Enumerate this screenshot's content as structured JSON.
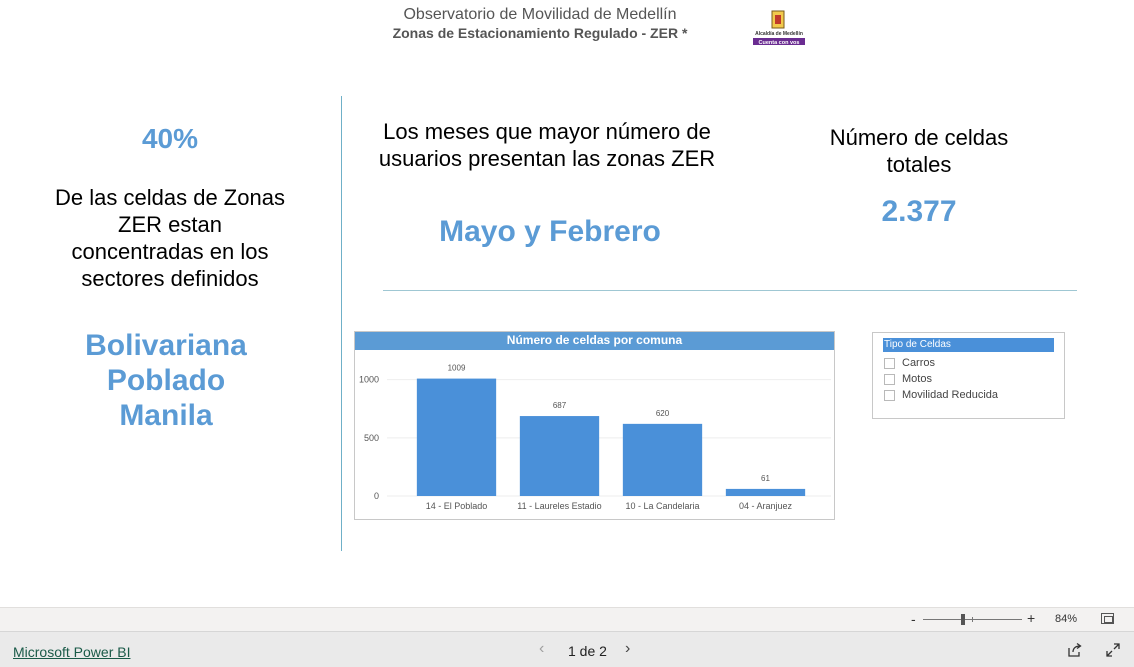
{
  "header": {
    "title": "Observatorio de Movilidad de Medellín",
    "subtitle": "Zonas de Estacionamiento Regulado - ZER *",
    "logo_text_1": "Alcaldía de Medellín",
    "logo_text_2": "Cuenta con vos"
  },
  "left_kpi": {
    "percent": "40%",
    "description": "De las celdas de Zonas ZER estan concentradas en los sectores definidos",
    "sectors": [
      "Bolivariana",
      "Poblado",
      "Manila"
    ]
  },
  "months_kpi": {
    "description": "Los meses que mayor número de usuarios presentan las zonas ZER",
    "value": "Mayo y Febrero"
  },
  "cells_kpi": {
    "description": "Número de celdas totales",
    "value": "2.377"
  },
  "chart_data": {
    "type": "bar",
    "title": "Número de celdas por comuna",
    "categories": [
      "14 - El Poblado",
      "11 - Laureles Estadio",
      "10 - La Candelaria",
      "04 - Aranjuez"
    ],
    "values": [
      1009,
      687,
      620,
      61
    ],
    "y_ticks": [
      0,
      500,
      1000
    ],
    "ylim": [
      0,
      1100
    ],
    "color": "#4a90d9",
    "grid": true
  },
  "slicer": {
    "title": "Tipo de Celdas",
    "items": [
      "Carros",
      "Motos",
      "Movilidad Reducida"
    ]
  },
  "zoom": {
    "minus": "-",
    "plus": "+",
    "value": "84%"
  },
  "footer": {
    "brand_link": "Microsoft Power BI",
    "prev": "‹",
    "pages": "1 de 2",
    "next": "›"
  }
}
